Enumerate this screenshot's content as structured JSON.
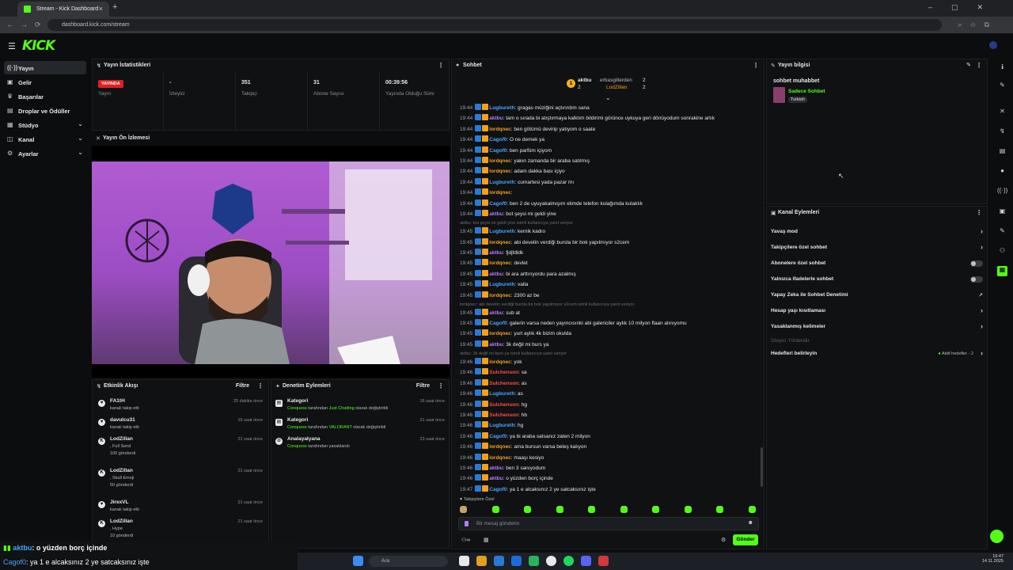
{
  "browser": {
    "tab_title": "Stream - Kick Dashboard",
    "url": "dashboard.kick.com/stream"
  },
  "header": {
    "logo": "KICK"
  },
  "sidebar": {
    "items": [
      {
        "label": "Yayın",
        "icon": "broadcast-icon"
      },
      {
        "label": "Gelir",
        "icon": "dollar-icon"
      },
      {
        "label": "Başarılar",
        "icon": "trophy-icon"
      },
      {
        "label": "Droplar ve Ödüller",
        "icon": "gift-icon"
      },
      {
        "label": "Stüdyo",
        "icon": "studio-icon"
      },
      {
        "label": "Kanal",
        "icon": "channel-icon"
      },
      {
        "label": "Ayarlar",
        "icon": "gear-icon"
      }
    ]
  },
  "stats": {
    "title": "Yayın İstatistikleri",
    "live_badge": "YAYINDA",
    "items": [
      {
        "value": "",
        "label": "Yayın"
      },
      {
        "value": "-",
        "label": "İzleyici"
      },
      {
        "value": "351",
        "label": "Takipçi"
      },
      {
        "value": "31",
        "label": "Abone Sayısı"
      },
      {
        "value": "00:39:56",
        "label": "Yayında Olduğu Süre"
      }
    ]
  },
  "preview": {
    "title": "Yayın Ön İzlemesi"
  },
  "activity": {
    "title": "Etkinlik Akışı",
    "filter": "Filtre",
    "items": [
      {
        "name": "FA1tH",
        "sub": "kanalı takip etti",
        "extra": "",
        "time": "25 dakika önce",
        "icon": "heart-icon"
      },
      {
        "name": "davulcu31",
        "sub": "kanalı takip etti",
        "extra": "",
        "time": "16 saat önce",
        "icon": "heart-icon"
      },
      {
        "name": "LodZillan",
        "sub": ", Full Send",
        "extra": "100 gönderdi",
        "time": "21 saat önce",
        "icon": "kick-icon"
      },
      {
        "name": "LodZillan",
        "sub": ", Skull Emoji",
        "extra": "50 gönderdi",
        "time": "21 saat önce",
        "icon": "kick-icon"
      },
      {
        "name": "JirexVL",
        "sub": "kanalı takip etti",
        "extra": "",
        "time": "21 saat önce",
        "icon": "heart-icon"
      },
      {
        "name": "LodZillan",
        "sub": ", Hype",
        "extra": "10 gönderdi",
        "time": "21 saat önce",
        "icon": "kick-icon"
      }
    ]
  },
  "moderation": {
    "title": "Denetim Eylemleri",
    "filter": "Filtre",
    "items": [
      {
        "title": "Kategori",
        "actor": "Conquess",
        "middle": " tarafından ",
        "target": "Just Chatting",
        "end": " olarak değiştirildi",
        "time": "16 saat önce"
      },
      {
        "title": "Kategori",
        "actor": "Conquess",
        "middle": " tarafından ",
        "target": "VALORANT",
        "end": " olarak değiştirildi",
        "time": "21 saat önce"
      },
      {
        "title": "Analayalyana",
        "actor": "Conquess",
        "middle": " tarafından yasaklandı",
        "target": "",
        "end": "",
        "time": "23 saat önce"
      }
    ]
  },
  "chat": {
    "title": "Sohbet",
    "top_gifters": [
      {
        "rank": "1",
        "name": "aktbu",
        "count": "2"
      },
      {
        "rank": "",
        "name": "erbasgillerden",
        "count": "2"
      },
      {
        "rank": "",
        "name": "LodZillan",
        "count": "2"
      }
    ],
    "messages": [
      {
        "time": "19:44",
        "user": "Lugbureth",
        "color": "#4aa3ff",
        "text": "gragas müziğini açtırırdım sana"
      },
      {
        "time": "19:44",
        "user": "aktbu",
        "color": "#b57bff",
        "text": "tam o sırada bi atıştırmaya kalktım bildirimi görünce uykuya geri dönüyodum sonrakine artık"
      },
      {
        "time": "19:44",
        "user": "lordqnec",
        "color": "#f2a01e",
        "text": "ben götümü devirip yatıyom o saate"
      },
      {
        "time": "19:44",
        "user": "Cagof0",
        "color": "#4aa3ff",
        "text": "O ne demek ya"
      },
      {
        "time": "19:44",
        "user": "Cagof0",
        "color": "#4aa3ff",
        "text": "ben parfüm içiyom"
      },
      {
        "time": "19:44",
        "user": "lordqnec",
        "color": "#f2a01e",
        "text": "yakın zamanda bir araba satılmış"
      },
      {
        "time": "19:44",
        "user": "lordqnec",
        "color": "#f2a01e",
        "text": "adam dakka bası içiyo"
      },
      {
        "time": "19:44",
        "user": "Lugbureth",
        "color": "#4aa3ff",
        "text": "cumartesi yada pazar mı"
      },
      {
        "time": "19:44",
        "user": "lordqnec",
        "color": "#f2a01e",
        "text": ""
      },
      {
        "time": "19:44",
        "user": "Cagof0",
        "color": "#4aa3ff",
        "text": "ben 2 de uyuyakalmışım elimde telefon kulağımda kulaklık"
      },
      {
        "time": "19:44",
        "user": "aktbu",
        "color": "#b57bff",
        "text": "bot şeysi mi geldi yine"
      },
      {
        "sys": "aktbu: bot şeysi mi geldi yine isimli kullanıcıya yanıt veriyor"
      },
      {
        "time": "19:45",
        "user": "Lugbureth",
        "color": "#4aa3ff",
        "text": "kemik kadro"
      },
      {
        "time": "19:45",
        "user": "lordqnec",
        "color": "#f2a01e",
        "text": "abi devetin verdiği bursla bir bok yapılmıyor s2cem"
      },
      {
        "time": "19:45",
        "user": "aktbu",
        "color": "#b57bff",
        "text": "fjdjfdldk"
      },
      {
        "time": "19:45",
        "user": "lordqnec",
        "color": "#f2a01e",
        "text": "devlet"
      },
      {
        "time": "19:45",
        "user": "aktbu",
        "color": "#b57bff",
        "text": "bi ara arttırıyordu para azalmış"
      },
      {
        "time": "19:45",
        "user": "Lugbureth",
        "color": "#4aa3ff",
        "text": "valla"
      },
      {
        "time": "19:45",
        "user": "lordqnec",
        "color": "#f2a01e",
        "text": "2300 az be"
      },
      {
        "sys": "lordqnec: abi devetin verdiği bursla bir bok yapılmıyor s2cem isimli kullanıcıya yanıt veriyor"
      },
      {
        "time": "19:45",
        "user": "aktbu",
        "color": "#b57bff",
        "text": "sub at"
      },
      {
        "time": "19:45",
        "user": "Cagof0",
        "color": "#4aa3ff",
        "text": "galerin varsa neden yayıncısınki abi galericiler aylık 10 milyon flaan alınıyomu"
      },
      {
        "time": "19:45",
        "user": "lordqnec",
        "color": "#f2a01e",
        "text": "yurt aylık 4k bizim okulda"
      },
      {
        "time": "19:45",
        "user": "aktbu",
        "color": "#b57bff",
        "text": "3k değil mi burs ya"
      },
      {
        "sys": "aktbu: 3k değil mi burs ya isimli kullanıcıya yanıt veriyor"
      },
      {
        "time": "19:46",
        "user": "lordqnec",
        "color": "#f2a01e",
        "text": "yok"
      },
      {
        "time": "19:46",
        "user": "Sulchenson",
        "color": "#ff4b4b",
        "text": "sa"
      },
      {
        "time": "19:46",
        "user": "Sulchenson",
        "color": "#ff4b4b",
        "text": "as"
      },
      {
        "time": "19:46",
        "user": "Lugbureth",
        "color": "#4aa3ff",
        "text": "as"
      },
      {
        "time": "19:46",
        "user": "Sulchenson",
        "color": "#ff4b4b",
        "text": "hg"
      },
      {
        "time": "19:46",
        "user": "Sulchenson",
        "color": "#ff4b4b",
        "text": "hb"
      },
      {
        "time": "19:46",
        "user": "Lugbureth",
        "color": "#4aa3ff",
        "text": "hg"
      },
      {
        "time": "19:46",
        "user": "Cagof0",
        "color": "#4aa3ff",
        "text": "ya bi araba satsanız zaten 2 milyon"
      },
      {
        "time": "19:46",
        "user": "lordqnec",
        "color": "#f2a01e",
        "text": "ama bursun varsa beleş kalıyon"
      },
      {
        "time": "19:46",
        "user": "lordqnec",
        "color": "#f2a01e",
        "text": "maaşı kesiyo"
      },
      {
        "time": "19:46",
        "user": "aktbu",
        "color": "#b57bff",
        "text": "ben 3 sanıyodum"
      },
      {
        "time": "19:46",
        "user": "aktbu",
        "color": "#b57bff",
        "text": "o yüzden borç içinde"
      },
      {
        "time": "19:47",
        "user": "Cagof0",
        "color": "#4aa3ff",
        "text": "ya 1 e alcaksınız 2 ye satcaksınız işte"
      }
    ],
    "followers_only": "Takipçilere Özel",
    "input_placeholder": "Bir mesaj gönderin",
    "send_label": "Gönder"
  },
  "stream_info": {
    "title": "Yayın bilgisi",
    "stream_title": "sohbet muhabbet",
    "category": "Sadece Sohbet",
    "tag": "Turkish"
  },
  "channel_actions": {
    "title": "Kanal Eylemleri",
    "items": [
      {
        "label": "Yavaş mod",
        "control": "chevron"
      },
      {
        "label": "Takipçilere özel sohbet",
        "control": "chevron"
      },
      {
        "label": "Abonelere özel sohbet",
        "control": "toggle"
      },
      {
        "label": "Yalnızca ifadelerle sohbet",
        "control": "toggle"
      },
      {
        "label": "Yapay Zeka ile Sohbet Denetimi",
        "control": "external"
      },
      {
        "label": "Hesap yaşı kısıtlaması",
        "control": "chevron"
      },
      {
        "label": "Yasaklanmış kelimeler",
        "control": "chevron"
      },
      {
        "label": "İzleyici Yönlendir",
        "control": "disabled"
      },
      {
        "label": "Hedefleri belirleyin",
        "control": "goal"
      }
    ],
    "goal_badge": "Aktif hedefler - 2"
  },
  "overlay": {
    "line1_user": "aktbu",
    "line1_text": ": o yüzden borç içinde",
    "line2_user": "Cagof0",
    "line2_text": ": ya 1 e alcaksınız 2 ye satcaksınız işte"
  },
  "taskbar": {
    "search": "Ara",
    "time": "19:47",
    "date": "14.11.2025"
  }
}
